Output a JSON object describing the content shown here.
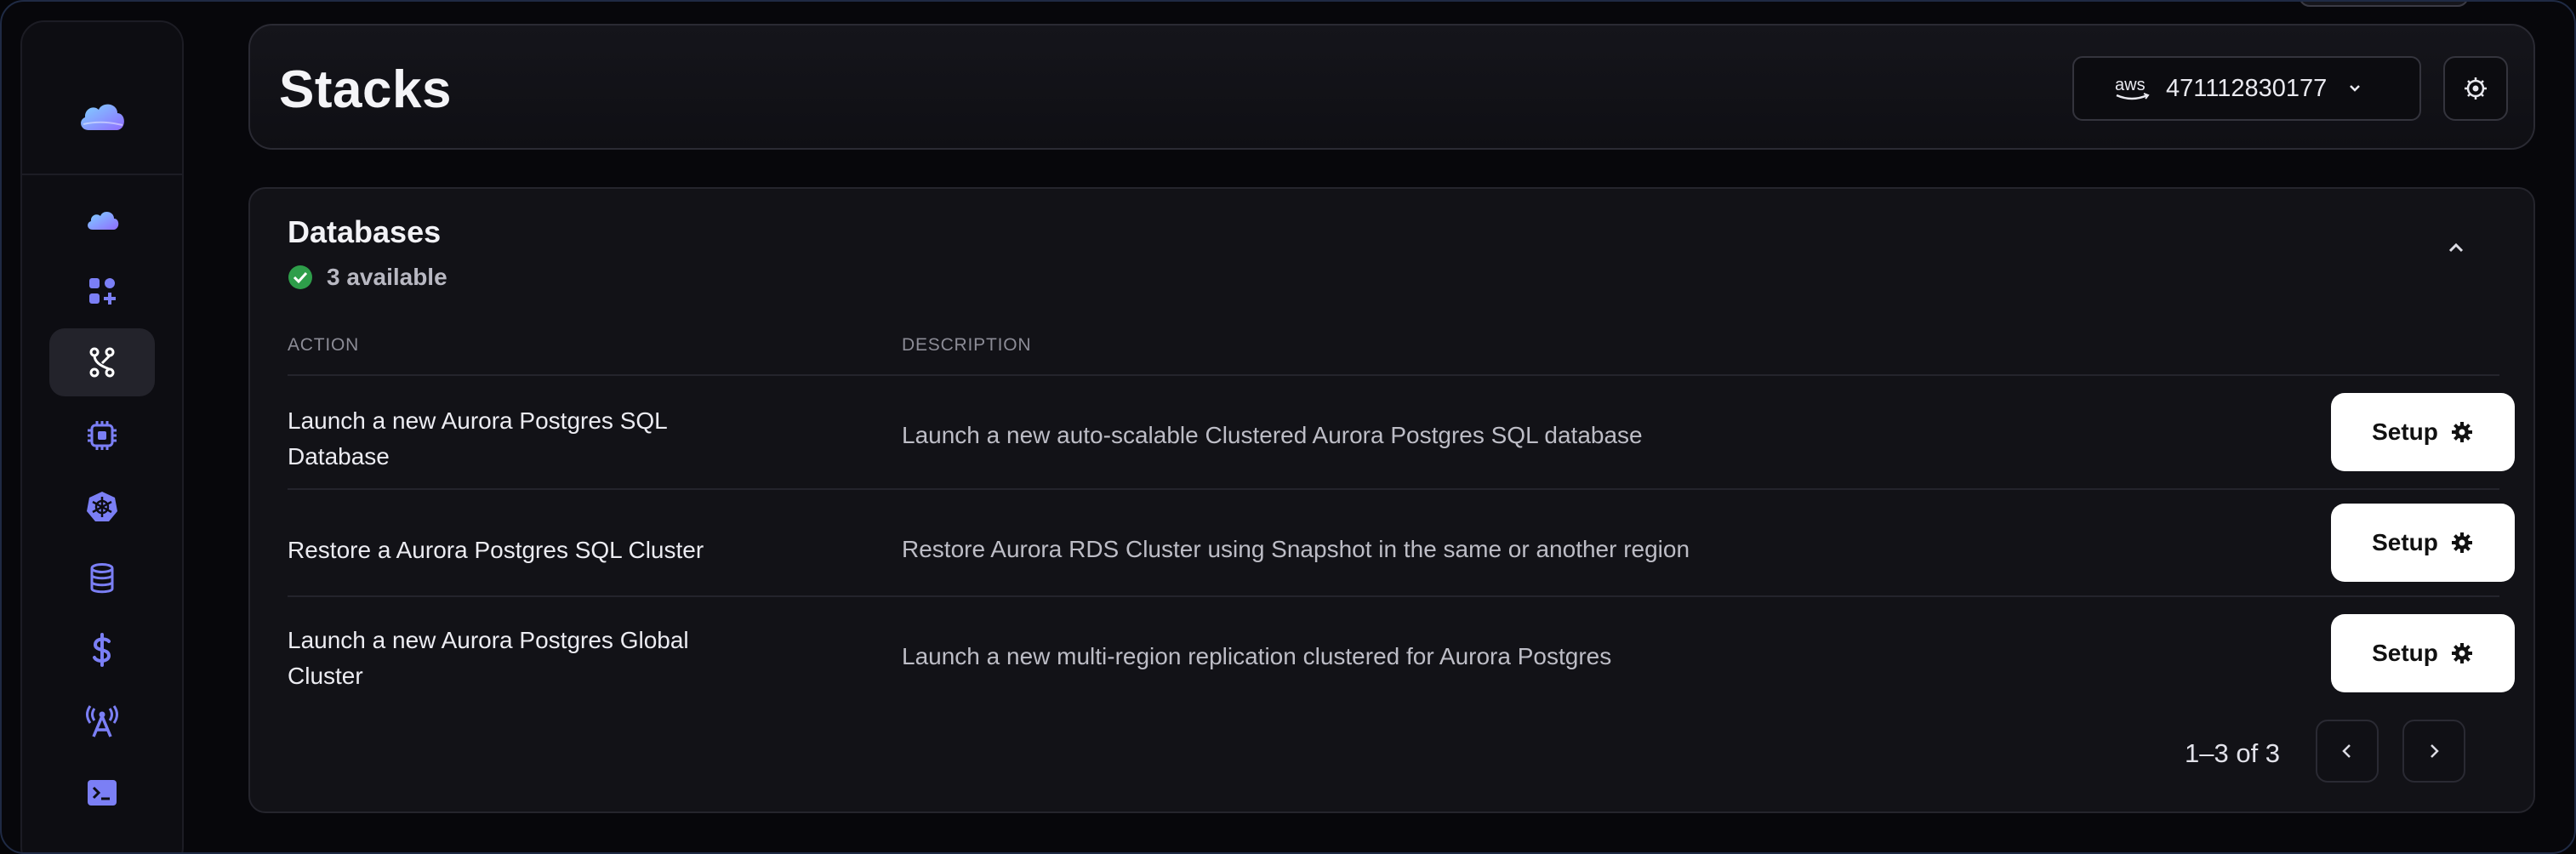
{
  "header": {
    "title": "Stacks",
    "account": {
      "provider_label": "aws",
      "account_id": "471112830177"
    }
  },
  "sidebar": {
    "items": [
      {
        "icon": "cloud-icon",
        "active": false
      },
      {
        "icon": "apps-add-icon",
        "active": false
      },
      {
        "icon": "git-merge-icon",
        "active": true
      },
      {
        "icon": "chip-icon",
        "active": false
      },
      {
        "icon": "helm-icon",
        "active": false
      },
      {
        "icon": "database-icon",
        "active": false
      },
      {
        "icon": "dollar-icon",
        "active": false
      },
      {
        "icon": "broadcast-tower-icon",
        "active": false
      },
      {
        "icon": "terminal-icon",
        "active": false
      }
    ]
  },
  "databases": {
    "title": "Databases",
    "status": "3 available",
    "columns": {
      "action": "ACTION",
      "description": "DESCRIPTION"
    },
    "rows": [
      {
        "action_line1": "Launch a new Aurora Postgres SQL",
        "action_line2": "Database",
        "description": "Launch a new auto-scalable Clustered Aurora Postgres SQL database",
        "button": "Setup"
      },
      {
        "action_line1": "Restore a Aurora Postgres SQL Cluster",
        "action_line2": "",
        "description": "Restore Aurora RDS Cluster using Snapshot in the same or another region",
        "button": "Setup"
      },
      {
        "action_line1": "Launch a new Aurora Postgres Global",
        "action_line2": "Cluster",
        "description": "Launch a new multi-region replication clustered for Aurora Postgres",
        "button": "Setup"
      }
    ],
    "pagination": "1–3 of 3"
  },
  "colors": {
    "accent": "#7b7ff5",
    "success": "#2e9e4a",
    "background": "#07070b"
  }
}
